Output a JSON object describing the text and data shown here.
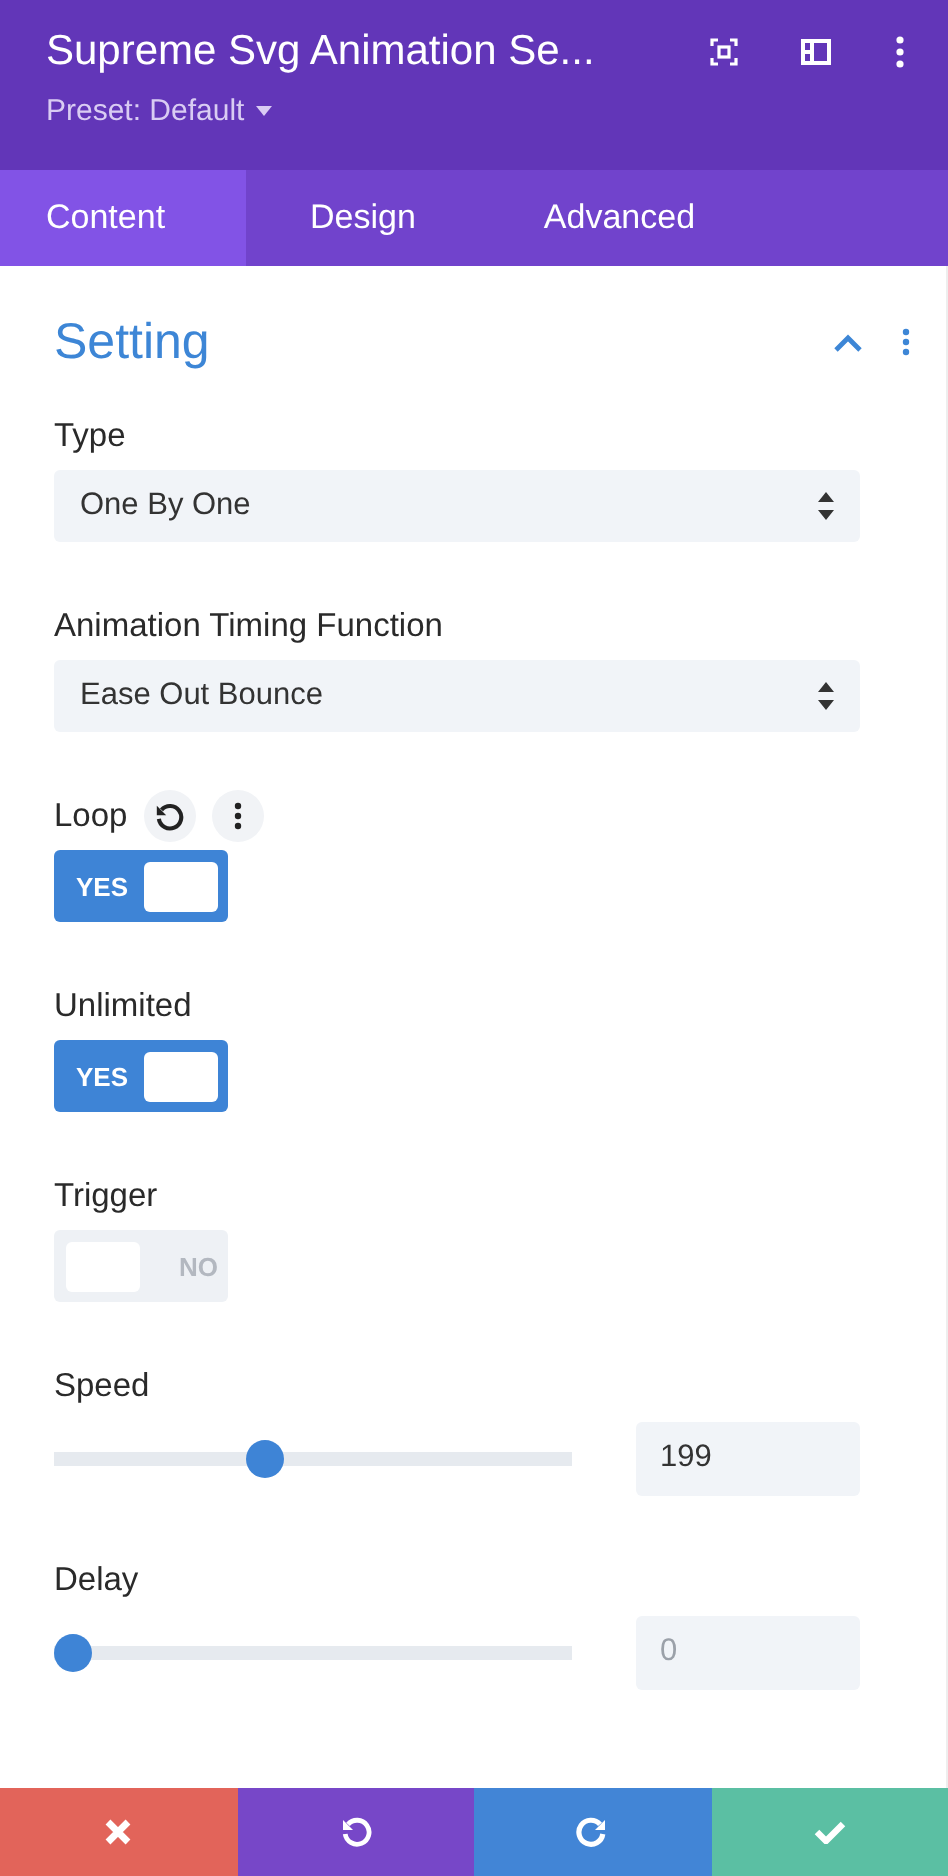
{
  "header": {
    "title": "Supreme Svg Animation Se...",
    "preset": "Preset: Default"
  },
  "tabs": [
    {
      "label": "Content",
      "selected": true
    },
    {
      "label": "Design",
      "selected": false
    },
    {
      "label": "Advanced",
      "selected": false
    }
  ],
  "section": {
    "title": "Setting",
    "expanded": true
  },
  "fields": [
    {
      "kind": "select",
      "label": "Type",
      "value": "One By One"
    },
    {
      "kind": "select",
      "label": "Animation Timing Function",
      "value": "Ease Out Bounce"
    },
    {
      "kind": "toggle",
      "label": "Loop",
      "on": true,
      "text": "YES",
      "hovered": true
    },
    {
      "kind": "toggle",
      "label": "Unlimited",
      "on": true,
      "text": "YES"
    },
    {
      "kind": "toggle",
      "label": "Trigger",
      "on": false,
      "text": "NO"
    },
    {
      "kind": "range",
      "label": "Speed",
      "level": 0.4,
      "value": "199"
    },
    {
      "kind": "range",
      "label": "Delay",
      "level": 0,
      "placeholder": "0"
    }
  ],
  "footer": [
    {
      "kind": "cancel"
    },
    {
      "kind": "undo"
    },
    {
      "kind": "redo"
    },
    {
      "kind": "save"
    }
  ]
}
